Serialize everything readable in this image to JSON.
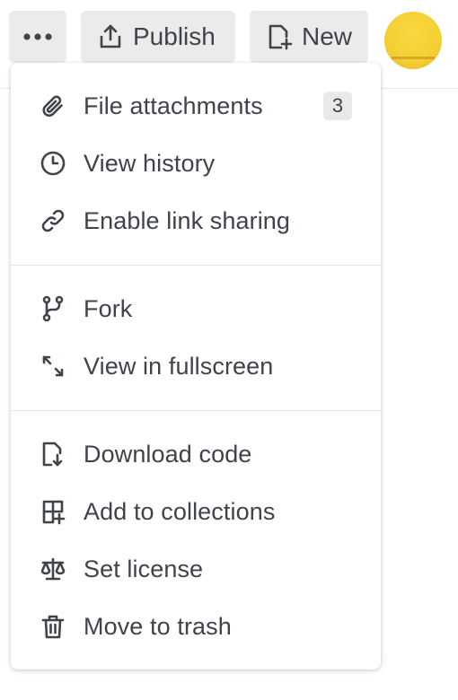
{
  "toolbar": {
    "more_icon": "more-horizontal-icon",
    "publish": {
      "label": "Publish",
      "icon": "upload-icon"
    },
    "new": {
      "label": "New",
      "icon": "new-document-icon"
    },
    "avatar_color": "#f4cf33"
  },
  "menu": {
    "groups": [
      [
        {
          "label": "File attachments",
          "icon": "paperclip-icon",
          "badge": "3"
        },
        {
          "label": "View history",
          "icon": "clock-icon"
        },
        {
          "label": "Enable link sharing",
          "icon": "link-icon"
        }
      ],
      [
        {
          "label": "Fork",
          "icon": "fork-icon"
        },
        {
          "label": "View in fullscreen",
          "icon": "fullscreen-icon"
        }
      ],
      [
        {
          "label": "Download code",
          "icon": "download-file-icon"
        },
        {
          "label": "Add to collections",
          "icon": "add-to-collection-icon"
        },
        {
          "label": "Set license",
          "icon": "scale-icon"
        },
        {
          "label": "Move to trash",
          "icon": "trash-icon"
        }
      ]
    ]
  },
  "colors": {
    "text": "#3f434a",
    "button_bg": "#ebebeb",
    "badge_bg": "#e9e9e9",
    "separator": "#e5e5e5"
  }
}
